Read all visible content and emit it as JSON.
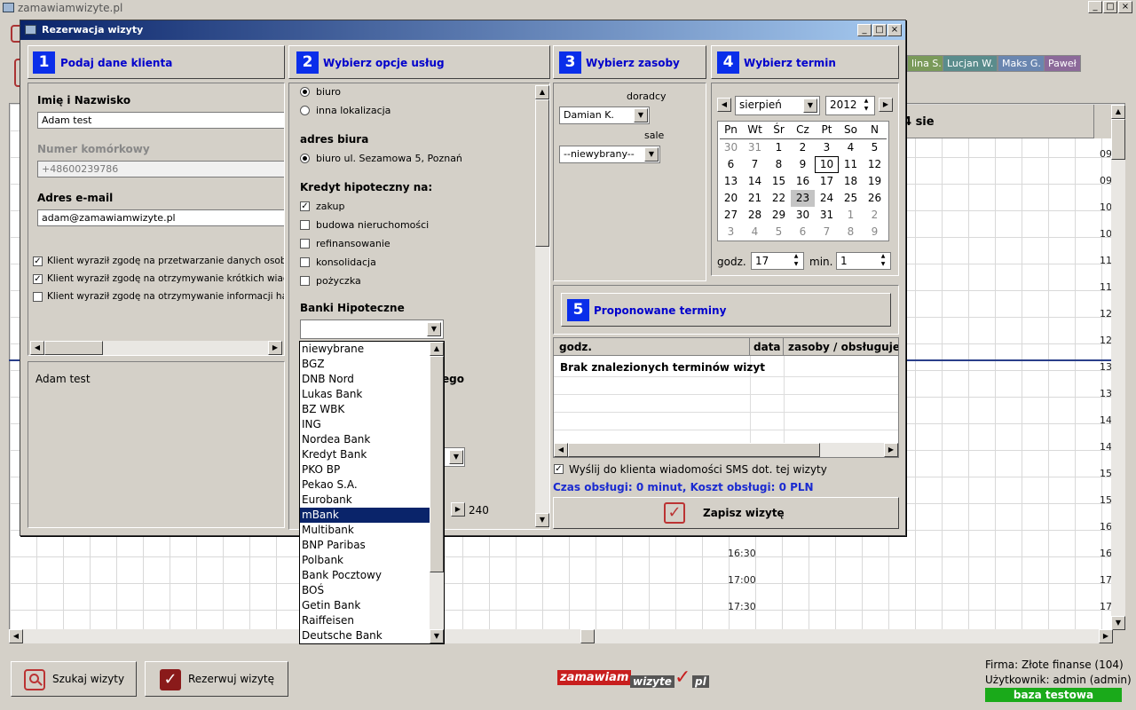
{
  "app": {
    "title": "zamawiamwizyte.pl"
  },
  "background_calendar": {
    "day_label": "4 sie",
    "time_slots_right": [
      "09",
      "09",
      "10",
      "10",
      "11",
      "11",
      "12",
      "12",
      "13",
      "13",
      "14",
      "14",
      "15",
      "15",
      "16",
      "16",
      "17",
      "17"
    ],
    "time_slots_mid": [
      "16:30",
      "17:00",
      "17:30"
    ],
    "resources": [
      {
        "label": "lina S.",
        "color": "#7a9a5a"
      },
      {
        "label": "Lucjan W.",
        "color": "#5a8c8c"
      },
      {
        "label": "Maks G.",
        "color": "#6a86b0"
      },
      {
        "label": "Paweł",
        "color": "#8c6a9a"
      }
    ]
  },
  "dialog": {
    "title": "Rezerwacja wizyty",
    "steps": [
      {
        "num": "1",
        "label": "Podaj dane klienta"
      },
      {
        "num": "2",
        "label": "Wybierz opcje usług"
      },
      {
        "num": "3",
        "label": "Wybierz zasoby"
      },
      {
        "num": "4",
        "label": "Wybierz termin"
      },
      {
        "num": "5",
        "label": "Proponowane terminy"
      }
    ],
    "client": {
      "name_label": "Imię i Nazwisko",
      "name_value": "Adam test",
      "phone_label": "Numer komórkowy",
      "phone_value": "+48600239786",
      "email_label": "Adres e-mail",
      "email_value": "adam@zamawiamwizyte.pl",
      "consents": [
        {
          "label": "Klient wyraził zgodę na przetwarzanie danych osobowy",
          "checked": true
        },
        {
          "label": "Klient wyraził zgodę na otrzymywanie krótkich wiadomo",
          "checked": true
        },
        {
          "label": "Klient wyraził zgodę na otrzymywanie informacji handlo",
          "checked": false
        }
      ],
      "notes": "Adam test"
    },
    "options": {
      "location": [
        {
          "label": "biuro",
          "selected": true
        },
        {
          "label": "inna lokalizacja",
          "selected": false
        }
      ],
      "office_address_label": "adres biura",
      "office_address": "biuro ul. Sezamowa 5, Poznań",
      "mortgage_label": "Kredyt hipoteczny na:",
      "mortgage_options": [
        {
          "label": "zakup",
          "checked": true
        },
        {
          "label": "budowa nieruchomości",
          "checked": false
        },
        {
          "label": "refinansowanie",
          "checked": false
        },
        {
          "label": "konsolidacja",
          "checked": false
        },
        {
          "label": "pożyczka",
          "checked": false
        }
      ],
      "banks_label": "Banki Hipoteczne",
      "banks_selected": "",
      "hidden_label_fragment": "ego",
      "duration_value": "240",
      "bank_list": [
        "niewybrane",
        "BGZ",
        "DNB Nord",
        "Lukas Bank",
        "BZ WBK",
        "ING",
        "Nordea Bank",
        "Kredyt Bank",
        "PKO BP",
        "Pekao S.A.",
        "Eurobank",
        "mBank",
        "Multibank",
        "BNP Paribas",
        "Polbank",
        "Bank Pocztowy",
        "BOŚ",
        "Getin Bank",
        "Raiffeisen",
        "Deutsche Bank"
      ],
      "bank_highlighted": "mBank"
    },
    "resources": {
      "advisors_label": "doradcy",
      "advisor_value": "Damian K.",
      "rooms_label": "sale",
      "room_value": "--niewybrany--"
    },
    "term": {
      "month": "sierpień",
      "year": "2012",
      "weekdays": [
        "Pn",
        "Wt",
        "Śr",
        "Cz",
        "Pt",
        "So",
        "N"
      ],
      "weeks": [
        [
          {
            "d": "30",
            "o": true
          },
          {
            "d": "31",
            "o": true
          },
          {
            "d": "1"
          },
          {
            "d": "2"
          },
          {
            "d": "3"
          },
          {
            "d": "4"
          },
          {
            "d": "5"
          }
        ],
        [
          {
            "d": "6"
          },
          {
            "d": "7"
          },
          {
            "d": "8"
          },
          {
            "d": "9"
          },
          {
            "d": "10",
            "today": true
          },
          {
            "d": "11"
          },
          {
            "d": "12"
          }
        ],
        [
          {
            "d": "13"
          },
          {
            "d": "14"
          },
          {
            "d": "15"
          },
          {
            "d": "16"
          },
          {
            "d": "17"
          },
          {
            "d": "18"
          },
          {
            "d": "19"
          }
        ],
        [
          {
            "d": "20"
          },
          {
            "d": "21"
          },
          {
            "d": "22"
          },
          {
            "d": "23",
            "sel": true
          },
          {
            "d": "24"
          },
          {
            "d": "25"
          },
          {
            "d": "26"
          }
        ],
        [
          {
            "d": "27"
          },
          {
            "d": "28"
          },
          {
            "d": "29"
          },
          {
            "d": "30"
          },
          {
            "d": "31"
          },
          {
            "d": "1",
            "o": true
          },
          {
            "d": "2",
            "o": true
          }
        ],
        [
          {
            "d": "3",
            "o": true
          },
          {
            "d": "4",
            "o": true
          },
          {
            "d": "5",
            "o": true
          },
          {
            "d": "6",
            "o": true
          },
          {
            "d": "7",
            "o": true
          },
          {
            "d": "8",
            "o": true
          },
          {
            "d": "9",
            "o": true
          }
        ]
      ],
      "hour_label": "godz.",
      "hour_value": "17",
      "minute_label": "min.",
      "minute_value": "1"
    },
    "proposed": {
      "columns": [
        "godz.",
        "data",
        "zasoby / obsługuje"
      ],
      "empty_message": "Brak znalezionych terminów wizyt"
    },
    "sms_label": "Wyślij do klienta wiadomości SMS dot. tej wizyty",
    "sms_checked": true,
    "summary": "Czas obsługi: 0 minut, Koszt obsługi: 0 PLN",
    "save_label": "Zapisz wizytę"
  },
  "footer": {
    "search_label": "Szukaj wizyty",
    "reserve_label": "Rezerwuj wizytę",
    "logo_left": "zamawiam",
    "logo_mid": "wizyte",
    "logo_right": "pl",
    "company": "Firma: Złote finanse (104)",
    "user": "Użytkownik: admin (admin)",
    "badge": "baza testowa",
    "badge_color": "#1aaa1a"
  }
}
